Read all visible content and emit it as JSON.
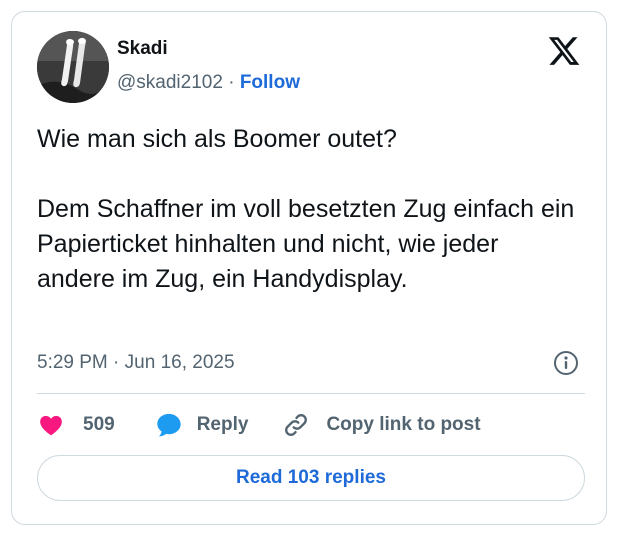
{
  "author": {
    "name": "Skadi",
    "handle": "@skadi2102",
    "separator": "·",
    "follow_label": "Follow"
  },
  "post": {
    "text": "Wie man sich als Boomer outet?\n\nDem Schaffner im voll besetzten Zug einfach ein Papierticket hinhalten und nicht, wie jeder andere im Zug, ein Handydisplay.",
    "time": "5:29 PM",
    "date": "Jun 16, 2025",
    "time_separator": "·"
  },
  "actions": {
    "like_count": "509",
    "reply_label": "Reply",
    "copy_link_label": "Copy link to post"
  },
  "read_replies_label": "Read 103 replies",
  "colors": {
    "like": "#f91880",
    "reply": "#1d9bf0",
    "link": "#1d6ad8",
    "muted": "#536471",
    "border": "#cfd9de"
  },
  "icons": [
    "x-logo-icon",
    "info-icon",
    "heart-icon",
    "reply-bubble-icon",
    "link-icon"
  ]
}
